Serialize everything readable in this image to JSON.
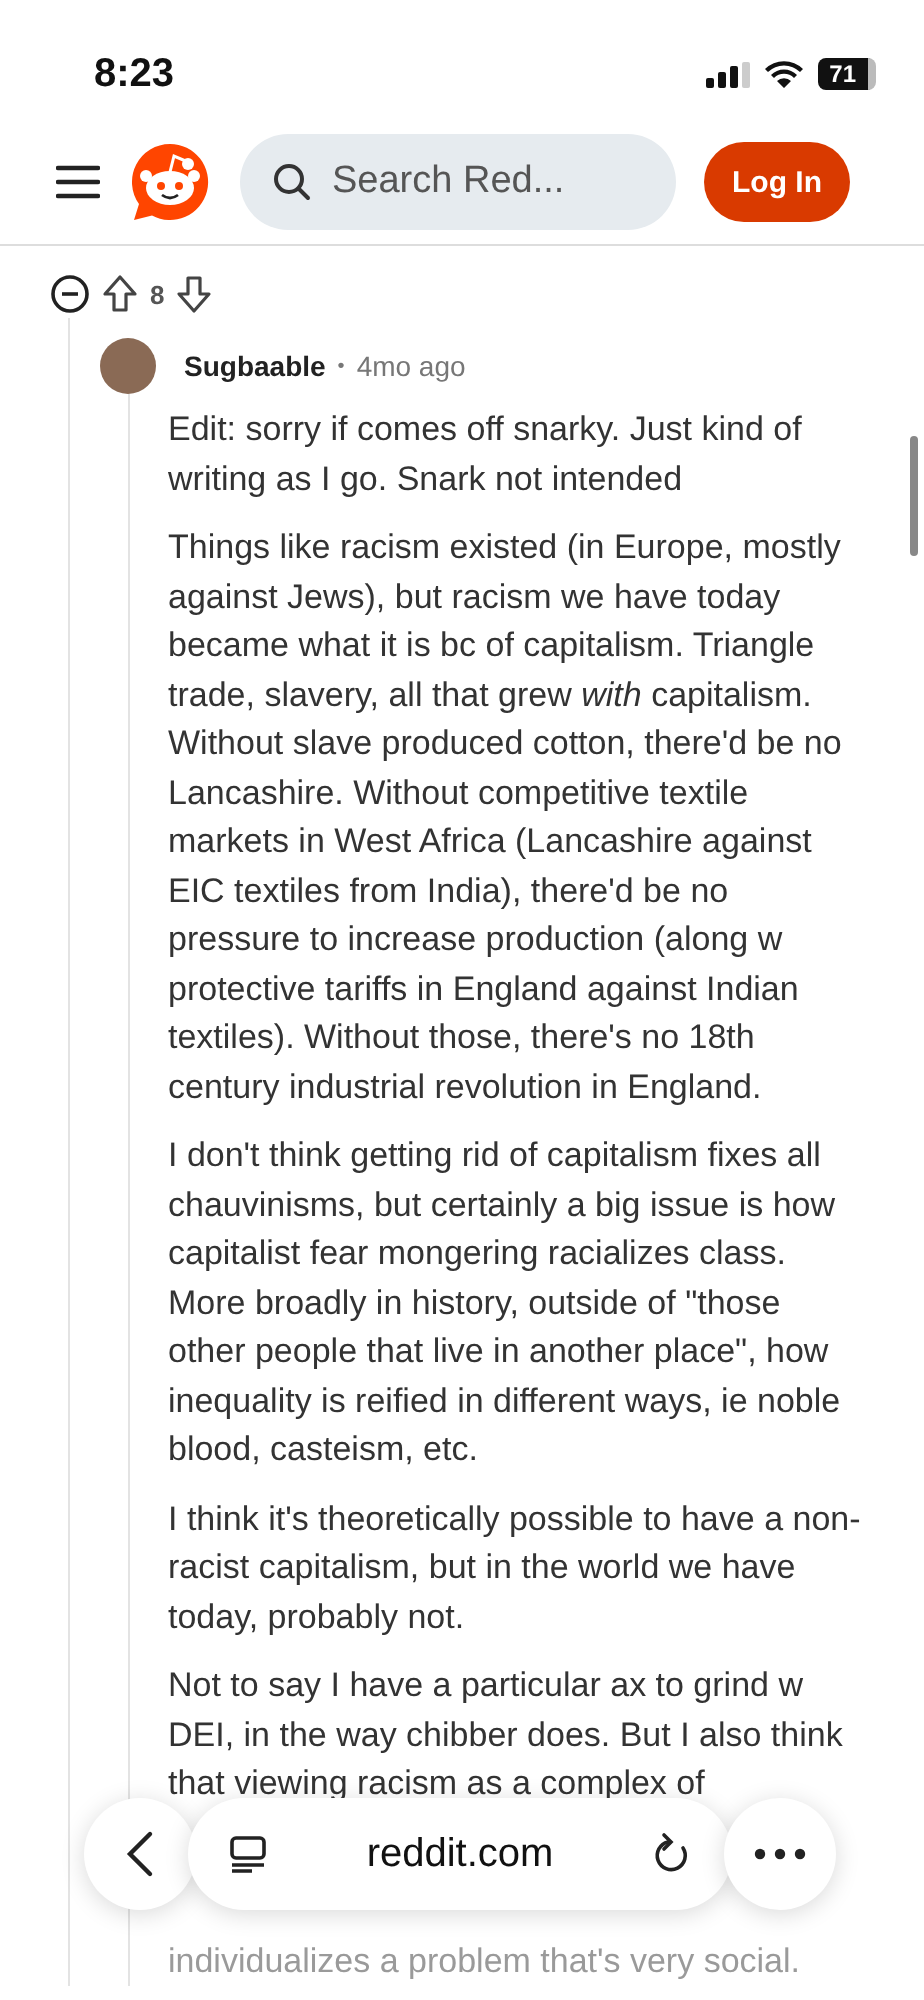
{
  "status_bar": {
    "time": "8:23",
    "battery": "71"
  },
  "header": {
    "search": {
      "placeholder": "Search Red..."
    },
    "login": "Log In"
  },
  "votes": {
    "count": "8"
  },
  "comment": {
    "author": "Sugbaable",
    "separator": "•",
    "time": "4mo ago",
    "paragraphs": [
      "Edit: sorry if comes off snarky. Just kind of writing as I go. Snark not intended",
      "Things like racism existed (in Europe, mostly against Jews), but racism we have today became what it is bc of capitalism. Triangle trade, slavery, all that grew *with* capitalism. Without slave produced cotton, there'd be no Lancashire. Without competitive textile markets in West Africa (Lancashire against EIC textiles from India), there'd be no pressure to increase production (along w protective tariffs in England against Indian textiles). Without those, there's no 18th century industrial revolution in England.",
      "I don't think getting rid of capitalism fixes all chauvinisms, but certainly a big issue is how capitalist fear mongering racializes class. More broadly in history, outside of \"those other people that live in another place\", how inequality is reified in different ways, ie noble blood, casteism, etc.",
      "I think it's theoretically possible to have a non-racist capitalism, but in the world we have today, probably not.",
      "Not to say I have a particular ax to grind w DEI, in the way chibber does. But I also think that viewing racism as a complex of"
    ],
    "faded_line": "individualizes a problem that's very social."
  },
  "browser_bar": {
    "url": "reddit.com"
  }
}
